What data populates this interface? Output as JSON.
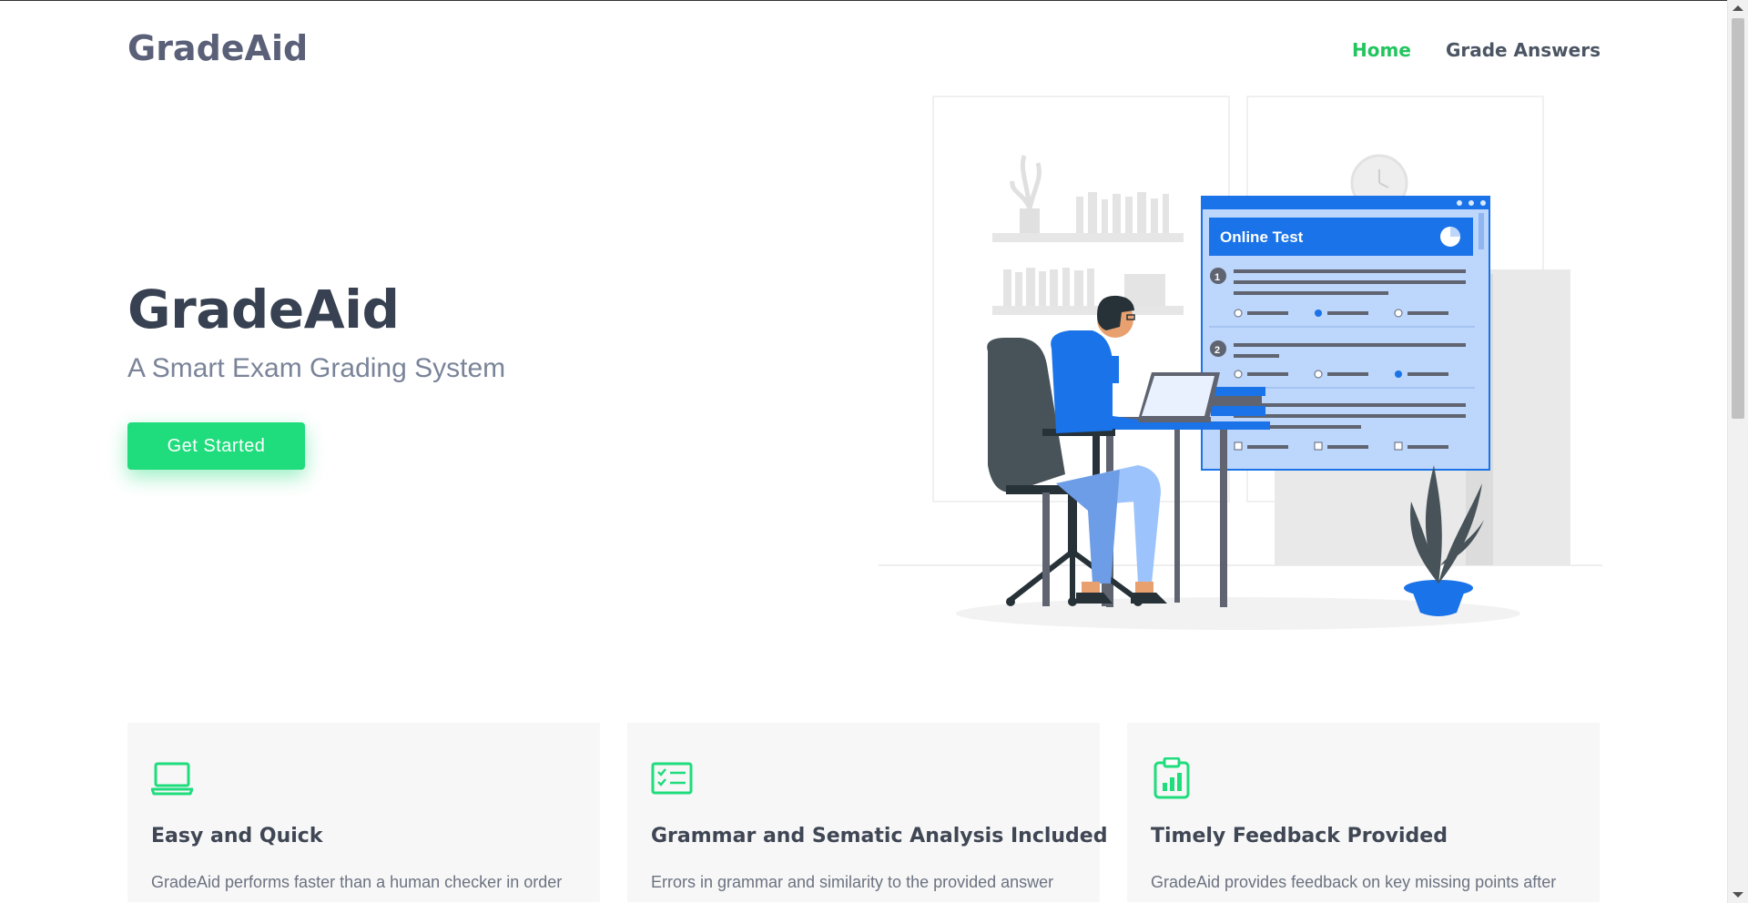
{
  "header": {
    "brand": "GradeAid",
    "nav": [
      {
        "label": "Home",
        "active": true
      },
      {
        "label": "Grade Answers",
        "active": false
      }
    ]
  },
  "hero": {
    "title": "GradeAid",
    "subtitle": "A Smart Exam Grading System",
    "cta_label": "Get Started"
  },
  "illustration": {
    "window_title": "Online Test",
    "question_numbers": [
      "1",
      "2"
    ]
  },
  "features": [
    {
      "icon": "laptop-icon",
      "title": "Easy and Quick",
      "text": "GradeAid performs faster than a human checker in order"
    },
    {
      "icon": "checklist-icon",
      "title": "Grammar and Sematic Analysis Included",
      "text": "Errors in grammar and similarity to the provided answer"
    },
    {
      "icon": "clipboard-chart-icon",
      "title": "Timely Feedback Provided",
      "text": "GradeAid provides feedback on key missing points after"
    }
  ],
  "colors": {
    "accent": "#22c55e",
    "button": "#1fdc7c",
    "illustration_blue": "#1a73e8"
  }
}
